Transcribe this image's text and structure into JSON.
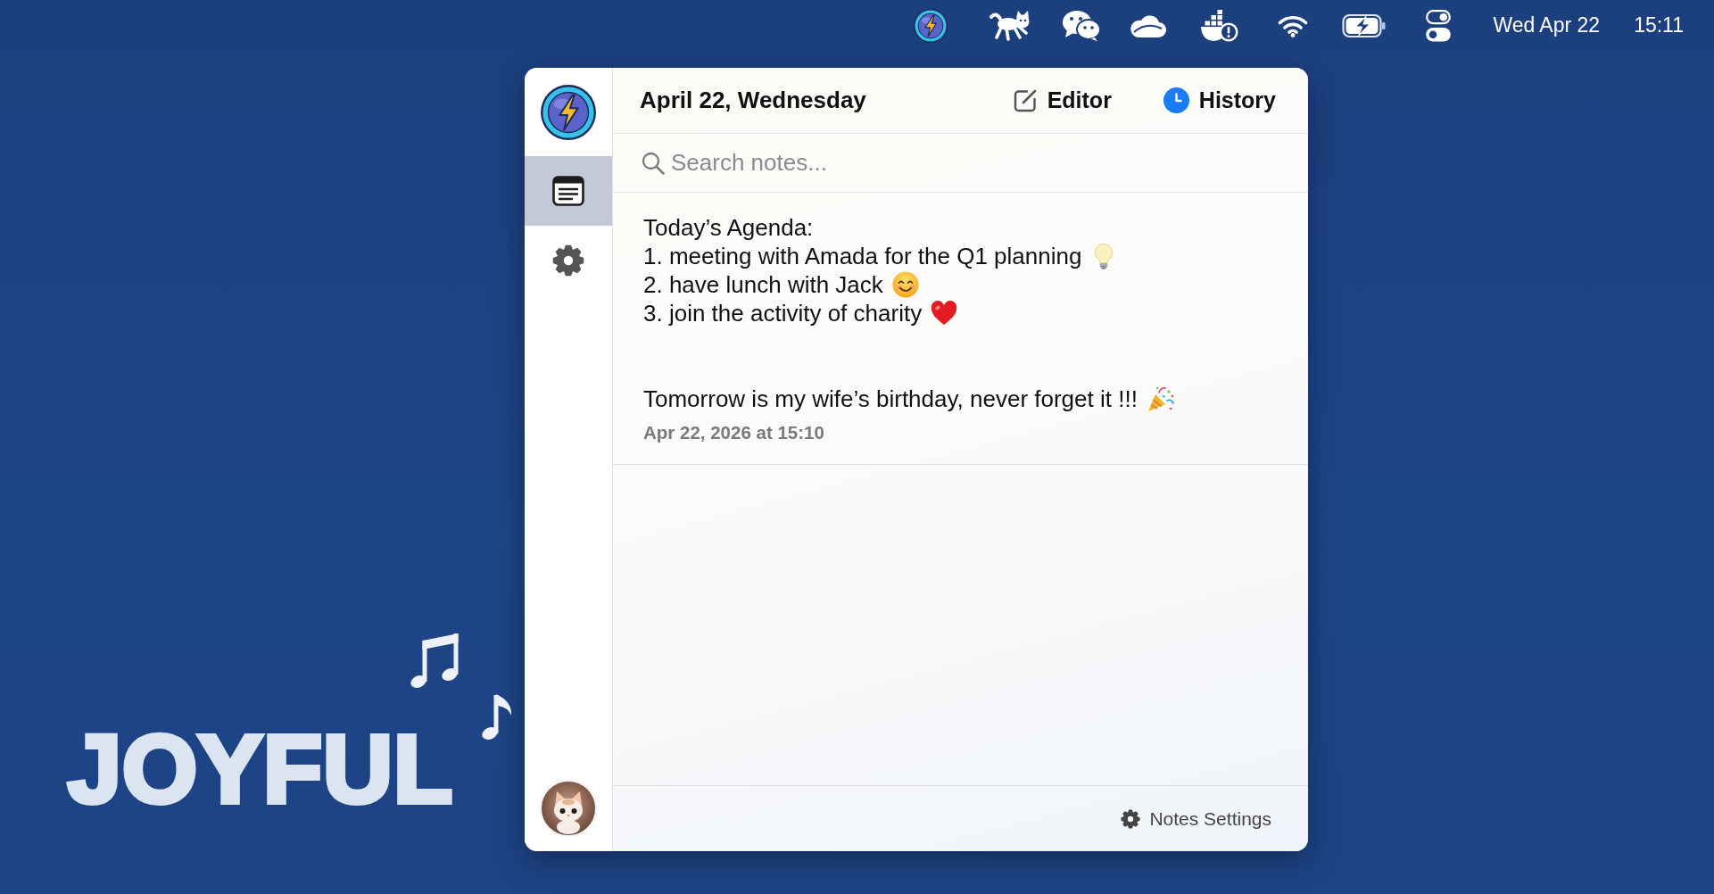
{
  "menubar": {
    "date": "Wed Apr 22",
    "time": "15:11"
  },
  "wallpaper": {
    "lettering": "JOYFUL"
  },
  "sidebar": {
    "items": [
      {
        "kind": "notes",
        "selected": true
      },
      {
        "kind": "settings",
        "selected": false
      }
    ]
  },
  "header": {
    "title": "April 22, Wednesday"
  },
  "tabs": [
    {
      "label": "Editor",
      "kind": "editor",
      "selected": false
    },
    {
      "label": "History",
      "kind": "history",
      "selected": true
    }
  ],
  "search": {
    "placeholder": "Search notes..."
  },
  "notes": [
    {
      "paragraphs": [
        [
          {
            "text": "Today’s Agenda:",
            "kind": "plain"
          },
          {
            "text": "1. meeting with Amada for the Q1 planning",
            "kind": "bulb"
          },
          {
            "text": "2. have lunch with Jack",
            "kind": "smile"
          },
          {
            "text": "3. join the activity of charity",
            "kind": "heart"
          }
        ],
        [
          {
            "text": "Tomorrow is my wife’s birthday, never forget it !!!",
            "kind": "party"
          }
        ]
      ],
      "date": "Apr 22, 2026 at 15:10"
    }
  ],
  "footer": {
    "settings_button": "Notes Settings"
  }
}
